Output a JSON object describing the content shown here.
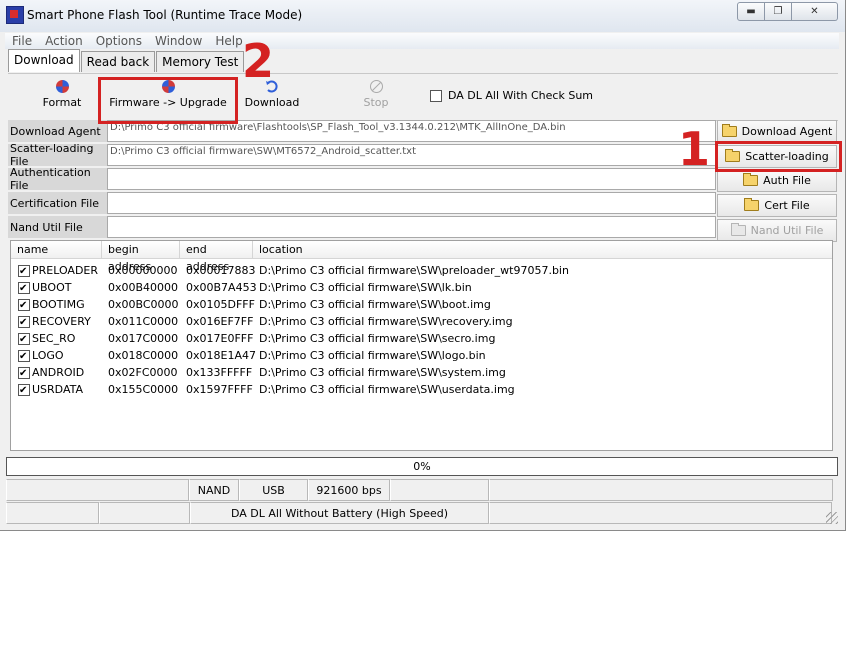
{
  "window": {
    "title": "Smart Phone Flash Tool (Runtime Trace Mode)"
  },
  "menu": [
    "File",
    "Action",
    "Options",
    "Window",
    "Help"
  ],
  "tabs": [
    "Download",
    "Read back",
    "Memory Test"
  ],
  "toolbar": {
    "format": "Format",
    "firmware_upgrade": "Firmware -> Upgrade",
    "download": "Download",
    "stop": "Stop",
    "checksum_label": "DA DL All With Check Sum"
  },
  "files": {
    "download_agent": {
      "label": "Download Agent",
      "value": "D:\\Primo C3 official firmware\\Flashtools\\SP_Flash_Tool_v3.1344.0.212\\MTK_AllInOne_DA.bin",
      "button": "Download Agent"
    },
    "scatter": {
      "label": "Scatter-loading File",
      "value": "D:\\Primo C3 official firmware\\SW\\MT6572_Android_scatter.txt",
      "button": "Scatter-loading"
    },
    "auth": {
      "label": "Authentication File",
      "value": "",
      "button": "Auth File"
    },
    "cert": {
      "label": "Certification File",
      "value": "",
      "button": "Cert File"
    },
    "nand": {
      "label": "Nand Util File",
      "value": "",
      "button": "Nand Util File"
    }
  },
  "table": {
    "headers": [
      "name",
      "begin address",
      "end address",
      "location"
    ],
    "rows": [
      {
        "name": "PRELOADER",
        "begin": "0x00000000",
        "end": "0x00017883",
        "location": "D:\\Primo C3 official firmware\\SW\\preloader_wt97057.bin",
        "checked": true
      },
      {
        "name": "UBOOT",
        "begin": "0x00B40000",
        "end": "0x00B7A453",
        "location": "D:\\Primo C3 official firmware\\SW\\lk.bin",
        "checked": true
      },
      {
        "name": "BOOTIMG",
        "begin": "0x00BC0000",
        "end": "0x0105DFFF",
        "location": "D:\\Primo C3 official firmware\\SW\\boot.img",
        "checked": true
      },
      {
        "name": "RECOVERY",
        "begin": "0x011C0000",
        "end": "0x016EF7FF",
        "location": "D:\\Primo C3 official firmware\\SW\\recovery.img",
        "checked": true
      },
      {
        "name": "SEC_RO",
        "begin": "0x017C0000",
        "end": "0x017E0FFF",
        "location": "D:\\Primo C3 official firmware\\SW\\secro.img",
        "checked": true
      },
      {
        "name": "LOGO",
        "begin": "0x018C0000",
        "end": "0x018E1A47",
        "location": "D:\\Primo C3 official firmware\\SW\\logo.bin",
        "checked": true
      },
      {
        "name": "ANDROID",
        "begin": "0x02FC0000",
        "end": "0x133FFFFF",
        "location": "D:\\Primo C3 official firmware\\SW\\system.img",
        "checked": true
      },
      {
        "name": "USRDATA",
        "begin": "0x155C0000",
        "end": "0x1597FFFF",
        "location": "D:\\Primo C3 official firmware\\SW\\userdata.img",
        "checked": true
      }
    ]
  },
  "progress": {
    "value": 0,
    "text": "0%"
  },
  "status": {
    "storage": "NAND",
    "port": "USB",
    "baud": "921600 bps",
    "mode": "DA DL All Without Battery (High Speed)"
  },
  "annotations": {
    "one": "1",
    "two": "2"
  },
  "colors": {
    "annotation": "#d42222"
  }
}
